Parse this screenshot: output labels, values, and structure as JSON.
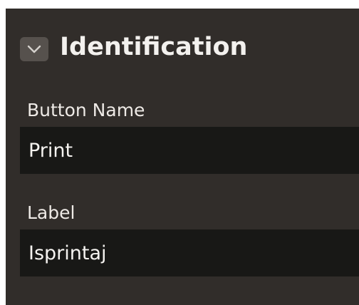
{
  "section": {
    "title": "Identification",
    "toggle_icon": "chevron-down-icon"
  },
  "fields": {
    "button_name": {
      "label": "Button Name",
      "value": "Print"
    },
    "label": {
      "label": "Label",
      "value": "Isprintaj"
    }
  },
  "colors": {
    "panel_bg": "#312d2a",
    "input_bg": "#181816",
    "toggle_bg": "#56514d",
    "text": "#f2f0ed"
  }
}
